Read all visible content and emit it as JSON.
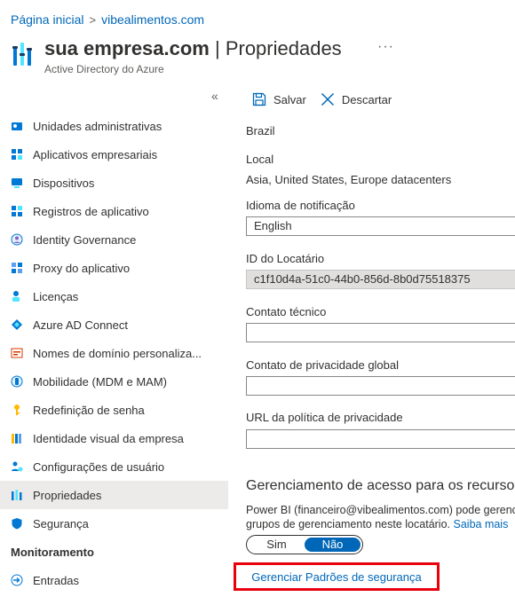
{
  "breadcrumb": {
    "items": [
      "Página inicial",
      "vibealimentos.com"
    ],
    "separator": ">"
  },
  "header": {
    "title_main": "sua empresa.com",
    "title_sep": " | Propriedades",
    "subtitle": "Active Directory do Azure",
    "more": "···"
  },
  "sidebar": {
    "collapse_glyph": "«",
    "items": [
      {
        "label": "Unidades administrativas",
        "icon": "admin-units-icon"
      },
      {
        "label": "Aplicativos empresariais",
        "icon": "enterprise-apps-icon"
      },
      {
        "label": "Dispositivos",
        "icon": "devices-icon"
      },
      {
        "label": "Registros de aplicativo",
        "icon": "app-registrations-icon"
      },
      {
        "label": "Identity Governance",
        "icon": "identity-governance-icon"
      },
      {
        "label": "Proxy do aplicativo",
        "icon": "app-proxy-icon"
      },
      {
        "label": "Licenças",
        "icon": "licenses-icon"
      },
      {
        "label": "Azure AD Connect",
        "icon": "ad-connect-icon"
      },
      {
        "label": "Nomes de domínio personaliza...",
        "icon": "custom-domain-icon"
      },
      {
        "label": "Mobilidade (MDM e MAM)",
        "icon": "mobility-icon"
      },
      {
        "label": "Redefinição de senha",
        "icon": "key-icon"
      },
      {
        "label": "Identidade visual da empresa",
        "icon": "branding-icon"
      },
      {
        "label": "Configurações de usuário",
        "icon": "user-settings-icon"
      },
      {
        "label": "Propriedades",
        "icon": "properties-icon",
        "active": true
      },
      {
        "label": "Segurança",
        "icon": "shield-icon"
      }
    ],
    "section_monitoring": "Monitoramento",
    "monitor_items": [
      {
        "label": "Entradas",
        "icon": "sign-ins-icon"
      }
    ]
  },
  "toolbar": {
    "save_label": "Salvar",
    "discard_label": "Descartar"
  },
  "form": {
    "country_value": "Brazil",
    "local_label": "Local",
    "local_value": "Asia, United States, Europe datacenters",
    "notification_label": "Idioma de notificação",
    "notification_value": "English",
    "tenant_label": "ID do Locatário",
    "tenant_value": "c1f10d4a-51c0-44b0-856d-8b0d75518375",
    "tech_contact_label": "Contato técnico",
    "tech_contact_value": "",
    "privacy_contact_label": "Contato de privacidade global",
    "privacy_contact_value": "",
    "privacy_url_label": "URL da política de privacidade",
    "privacy_url_value": ""
  },
  "access": {
    "heading": "Gerenciamento de acesso para os recursos",
    "text_line1": "Power BI (financeiro@vibealimentos.com) pode gerenciar",
    "text_line2": "grupos de gerenciamento neste locatário.",
    "learn_more": "Saiba mais",
    "toggle_yes": "Sim",
    "toggle_no": "Não",
    "selected": "Não"
  },
  "manage_defaults_link": "Gerenciar Padrões de segurança",
  "colors": {
    "link": "#0067b8",
    "toggle_on": "#0067b8",
    "highlight_border": "#e8000d",
    "active_nav_bg": "#edebe9"
  }
}
